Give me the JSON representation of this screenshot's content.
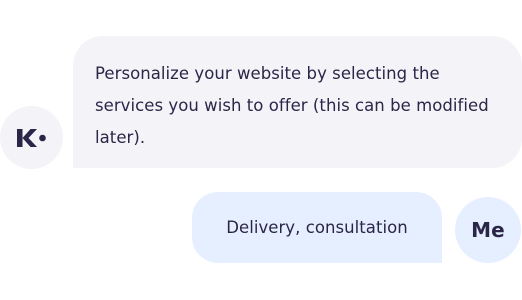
{
  "bot": {
    "avatar_icon": "brand-logo-icon",
    "message": "Personalize your website by selecting the services you wish to offer (this can be modified later)."
  },
  "user": {
    "message": "Delivery, consultation",
    "avatar_label": "Me"
  },
  "colors": {
    "bot_bubble": "#f4f3f8",
    "user_bubble": "#e6efff",
    "text": "#2b2548"
  }
}
